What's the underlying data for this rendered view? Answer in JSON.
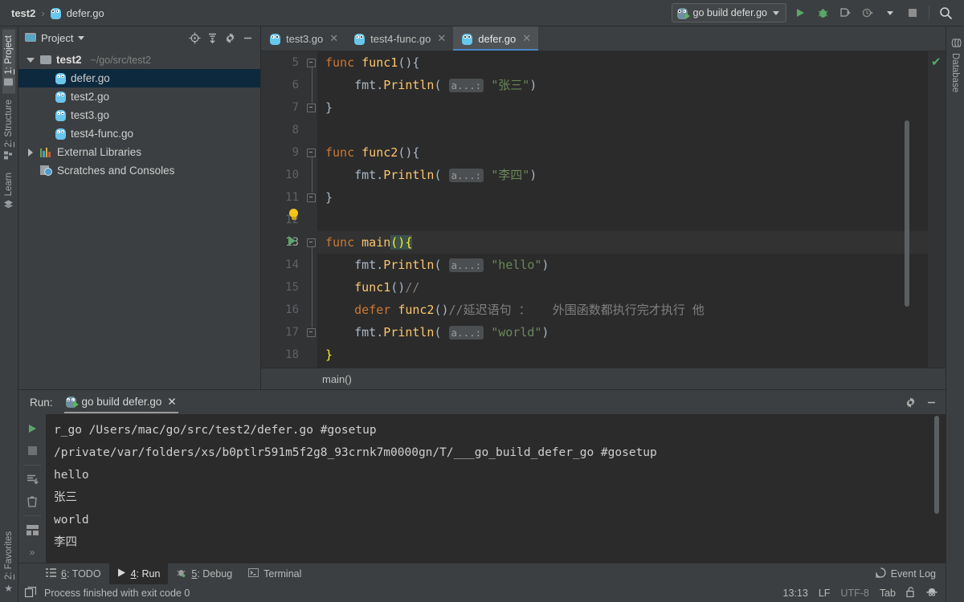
{
  "breadcrumb": {
    "project": "test2",
    "separator": "›",
    "file": "defer.go",
    "file_icon": "go-file-icon"
  },
  "toolbar": {
    "run_config": "go build defer.go",
    "dropdown_icon": "chevron-down-icon",
    "run_icon": "run-icon",
    "debug_icon": "debug-icon",
    "coverage_icon": "run-with-coverage-icon",
    "profile_icon": "run-with-profiler-icon",
    "profile_chevron_icon": "chevron-down-icon",
    "stop_icon": "stop-icon",
    "search_icon": "search-everywhere-icon"
  },
  "left_rail": {
    "top": [
      {
        "label_prefix": "1",
        "label": ": Project",
        "icon": "project-folder-icon",
        "active": true
      },
      {
        "label_prefix": "2",
        "label": ": Structure",
        "icon": "structure-icon",
        "active": false
      },
      {
        "label_prefix": "",
        "label": "Learn",
        "icon": "learn-icon",
        "active": false
      }
    ],
    "bottom": [
      {
        "label_prefix": "2",
        "label": ": Favorites",
        "icon": "star-icon",
        "active": false
      }
    ]
  },
  "right_rail": {
    "items": [
      {
        "label": "Database",
        "icon": "database-icon"
      }
    ]
  },
  "project_panel": {
    "title": "Project",
    "title_icon": "project-view-icon",
    "chevron_icon": "chevron-down-icon",
    "actions": [
      {
        "name": "locate-icon"
      },
      {
        "name": "collapse-all-icon"
      },
      {
        "name": "gear-icon"
      },
      {
        "name": "hide-icon"
      }
    ],
    "tree": [
      {
        "indent": 0,
        "arrow": "down",
        "icon": "folder-icon",
        "label": "test2",
        "bold": true,
        "path": "~/go/src/test2",
        "selected": false
      },
      {
        "indent": 1,
        "arrow": "none",
        "icon": "go-file-icon",
        "label": "defer.go",
        "bold": false,
        "path": "",
        "selected": true
      },
      {
        "indent": 1,
        "arrow": "none",
        "icon": "go-file-icon",
        "label": "test2.go",
        "bold": false,
        "path": "",
        "selected": false
      },
      {
        "indent": 1,
        "arrow": "none",
        "icon": "go-file-icon",
        "label": "test3.go",
        "bold": false,
        "path": "",
        "selected": false
      },
      {
        "indent": 1,
        "arrow": "none",
        "icon": "go-file-icon",
        "label": "test4-func.go",
        "bold": false,
        "path": "",
        "selected": false
      },
      {
        "indent": 0,
        "arrow": "right",
        "icon": "libraries-icon",
        "label": "External Libraries",
        "bold": false,
        "path": "",
        "selected": false
      },
      {
        "indent": 0,
        "arrow": "none",
        "icon": "scratches-icon",
        "label": "Scratches and Consoles",
        "bold": false,
        "path": "",
        "selected": false
      }
    ]
  },
  "editor": {
    "tabs": [
      {
        "label": "test3.go",
        "icon": "go-file-icon",
        "close_icon": "close-icon",
        "active": false
      },
      {
        "label": "test4-func.go",
        "icon": "go-file-icon",
        "close_icon": "close-icon",
        "active": false
      },
      {
        "label": "defer.go",
        "icon": "go-file-icon",
        "close_icon": "close-icon",
        "active": true
      }
    ],
    "inspection_status_icon": "ok-check-icon",
    "breadcrumb_bottom": "main()",
    "first_line_number": 5,
    "lines": [
      {
        "num": "5",
        "gutter": "fold-start",
        "segments": [
          {
            "t": "func ",
            "c": "kw"
          },
          {
            "t": "func1",
            "c": "fn"
          },
          {
            "t": "(){",
            "c": "punc"
          }
        ]
      },
      {
        "num": "6",
        "gutter": "",
        "segments": [
          {
            "t": "    fmt",
            "c": "pkg"
          },
          {
            "t": ".",
            "c": "punc"
          },
          {
            "t": "Println",
            "c": "fn"
          },
          {
            "t": "( ",
            "c": "punc"
          },
          {
            "t": "a...:",
            "c": "hint"
          },
          {
            "t": " ",
            "c": "punc"
          },
          {
            "t": "\"张三\"",
            "c": "str"
          },
          {
            "t": ")",
            "c": "punc"
          }
        ]
      },
      {
        "num": "7",
        "gutter": "fold-end",
        "segments": [
          {
            "t": "}",
            "c": "punc"
          }
        ]
      },
      {
        "num": "8",
        "gutter": "",
        "segments": []
      },
      {
        "num": "9",
        "gutter": "fold-start",
        "segments": [
          {
            "t": "func ",
            "c": "kw"
          },
          {
            "t": "func2",
            "c": "fn"
          },
          {
            "t": "(){",
            "c": "punc"
          }
        ]
      },
      {
        "num": "10",
        "gutter": "",
        "segments": [
          {
            "t": "    fmt",
            "c": "pkg"
          },
          {
            "t": ".",
            "c": "punc"
          },
          {
            "t": "Println",
            "c": "fn"
          },
          {
            "t": "( ",
            "c": "punc"
          },
          {
            "t": "a...:",
            "c": "hint"
          },
          {
            "t": " ",
            "c": "punc"
          },
          {
            "t": "\"李四\"",
            "c": "str"
          },
          {
            "t": ")",
            "c": "punc"
          }
        ]
      },
      {
        "num": "11",
        "gutter": "fold-end",
        "segments": [
          {
            "t": "}",
            "c": "punc"
          }
        ]
      },
      {
        "num": "12",
        "gutter": "bulb",
        "segments": []
      },
      {
        "num": "13",
        "gutter": "run-marker",
        "current": true,
        "segments": [
          {
            "t": "func ",
            "c": "kw"
          },
          {
            "t": "main",
            "c": "fn"
          },
          {
            "t": "(){",
            "c": "brk"
          }
        ]
      },
      {
        "num": "14",
        "gutter": "",
        "segments": [
          {
            "t": "    fmt",
            "c": "pkg"
          },
          {
            "t": ".",
            "c": "punc"
          },
          {
            "t": "Println",
            "c": "fn"
          },
          {
            "t": "( ",
            "c": "punc"
          },
          {
            "t": "a...:",
            "c": "hint"
          },
          {
            "t": " ",
            "c": "punc"
          },
          {
            "t": "\"hello\"",
            "c": "str"
          },
          {
            "t": ")",
            "c": "punc"
          }
        ]
      },
      {
        "num": "15",
        "gutter": "",
        "segments": [
          {
            "t": "    ",
            "c": "punc"
          },
          {
            "t": "func1",
            "c": "fn"
          },
          {
            "t": "()",
            "c": "punc"
          },
          {
            "t": "//",
            "c": "cmt"
          }
        ]
      },
      {
        "num": "16",
        "gutter": "",
        "segments": [
          {
            "t": "    ",
            "c": "punc"
          },
          {
            "t": "defer ",
            "c": "kw"
          },
          {
            "t": "func2",
            "c": "fn"
          },
          {
            "t": "()",
            "c": "punc"
          },
          {
            "t": "//延迟语句 ：   外围函数都执行完才执行 他",
            "c": "cmt"
          }
        ]
      },
      {
        "num": "17",
        "gutter": "",
        "segments": [
          {
            "t": "    fmt",
            "c": "pkg"
          },
          {
            "t": ".",
            "c": "punc"
          },
          {
            "t": "Println",
            "c": "fn"
          },
          {
            "t": "( ",
            "c": "punc"
          },
          {
            "t": "a...:",
            "c": "hint"
          },
          {
            "t": " ",
            "c": "punc"
          },
          {
            "t": "\"world\"",
            "c": "str"
          },
          {
            "t": ")",
            "c": "punc"
          }
        ]
      },
      {
        "num": "18",
        "gutter": "fold-end",
        "segments": [
          {
            "t": "}",
            "c": "brkY"
          }
        ]
      }
    ]
  },
  "run_panel": {
    "label": "Run:",
    "tab_label": "go build defer.go",
    "tab_icon": "go-run-icon",
    "tab_close_icon": "close-icon",
    "settings_icon": "gear-icon",
    "hide_icon": "hide-icon",
    "side_actions": [
      {
        "name": "rerun-icon"
      },
      {
        "name": "stop-icon"
      },
      {
        "name": "scroll-to-end-icon"
      },
      {
        "name": "clear-all-icon"
      },
      {
        "name": "layout-icon"
      },
      {
        "name": "expand-icon"
      }
    ],
    "console_lines": [
      "r_go /Users/mac/go/src/test2/defer.go #gosetup",
      "/private/var/folders/xs/b0ptlr591m5f2g8_93crnk7m0000gn/T/___go_build_defer_go #gosetup",
      "hello",
      "张三",
      "world",
      "李四"
    ]
  },
  "tool_window_bar": {
    "items": [
      {
        "prefix": "6",
        "label": ": TODO",
        "icon": "todo-icon",
        "active": false
      },
      {
        "prefix": "4",
        "label": ": Run",
        "icon": "run-icon",
        "active": true
      },
      {
        "prefix": "5",
        "label": ": Debug",
        "icon": "debug-icon",
        "active": false
      },
      {
        "prefix": "",
        "label": "Terminal",
        "icon": "terminal-icon",
        "active": false
      }
    ],
    "event_log": {
      "label": "Event Log",
      "icon": "event-log-icon"
    }
  },
  "status_bar": {
    "message": "Process finished with exit code 0",
    "message_icon": "console-icon",
    "caret_position": "13:13",
    "line_separator": "LF",
    "encoding": "UTF-8",
    "indent": "Tab",
    "lock_icon": "unlocked-icon",
    "inspector_icon": "inspector-hat-icon"
  },
  "colors": {
    "accent_blue": "#4a88c7",
    "selection_blue": "#0d293e",
    "green_run": "#59a869",
    "keyword_orange": "#cc7832",
    "function_yellow": "#ffc66d",
    "string_green": "#6a8759",
    "comment_gray": "#808080",
    "editor_bg": "#2b2b2b",
    "panel_bg": "#3c3f41"
  }
}
